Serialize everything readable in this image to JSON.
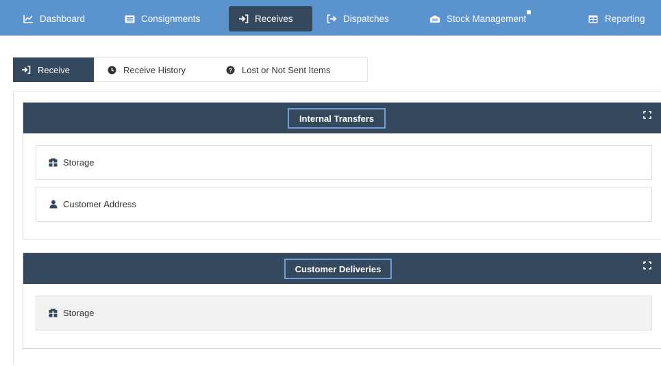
{
  "nav": {
    "items": [
      {
        "label": "Dashboard",
        "icon": "line-chart-icon"
      },
      {
        "label": "Consignments",
        "icon": "list-icon"
      },
      {
        "label": "Receives",
        "icon": "sign-in-icon",
        "active": true
      },
      {
        "label": "Dispatches",
        "icon": "sign-out-icon"
      },
      {
        "label": "Stock Management",
        "icon": "warehouse-icon"
      },
      {
        "label": "Reporting",
        "icon": "table-icon"
      }
    ]
  },
  "tabs": [
    {
      "label": "Receive",
      "icon": "sign-in-icon",
      "active": true
    },
    {
      "label": "Receive History",
      "icon": "clock-icon"
    },
    {
      "label": "Lost or Not Sent Items",
      "icon": "question-circle-icon"
    }
  ],
  "panels": [
    {
      "title": "Internal Transfers",
      "rows": [
        {
          "label": "Storage",
          "icon": "storage-icon"
        },
        {
          "label": "Customer Address",
          "icon": "user-icon"
        }
      ]
    },
    {
      "title": "Customer Deliveries",
      "rows": [
        {
          "label": "Storage",
          "icon": "storage-icon"
        }
      ]
    }
  ],
  "colors": {
    "nav_bg": "#5b93cf",
    "dark": "#34495e",
    "highlight_border": "#6f9fd6"
  }
}
